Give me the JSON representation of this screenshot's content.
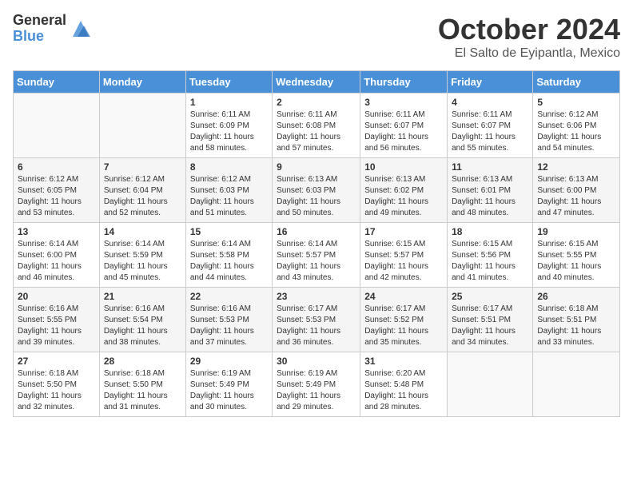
{
  "header": {
    "logo_general": "General",
    "logo_blue": "Blue",
    "month_title": "October 2024",
    "location": "El Salto de Eyipantla, Mexico"
  },
  "days_of_week": [
    "Sunday",
    "Monday",
    "Tuesday",
    "Wednesday",
    "Thursday",
    "Friday",
    "Saturday"
  ],
  "weeks": [
    [
      {
        "day": "",
        "sunrise": "",
        "sunset": "",
        "daylight": ""
      },
      {
        "day": "",
        "sunrise": "",
        "sunset": "",
        "daylight": ""
      },
      {
        "day": "1",
        "sunrise": "Sunrise: 6:11 AM",
        "sunset": "Sunset: 6:09 PM",
        "daylight": "Daylight: 11 hours and 58 minutes."
      },
      {
        "day": "2",
        "sunrise": "Sunrise: 6:11 AM",
        "sunset": "Sunset: 6:08 PM",
        "daylight": "Daylight: 11 hours and 57 minutes."
      },
      {
        "day": "3",
        "sunrise": "Sunrise: 6:11 AM",
        "sunset": "Sunset: 6:07 PM",
        "daylight": "Daylight: 11 hours and 56 minutes."
      },
      {
        "day": "4",
        "sunrise": "Sunrise: 6:11 AM",
        "sunset": "Sunset: 6:07 PM",
        "daylight": "Daylight: 11 hours and 55 minutes."
      },
      {
        "day": "5",
        "sunrise": "Sunrise: 6:12 AM",
        "sunset": "Sunset: 6:06 PM",
        "daylight": "Daylight: 11 hours and 54 minutes."
      }
    ],
    [
      {
        "day": "6",
        "sunrise": "Sunrise: 6:12 AM",
        "sunset": "Sunset: 6:05 PM",
        "daylight": "Daylight: 11 hours and 53 minutes."
      },
      {
        "day": "7",
        "sunrise": "Sunrise: 6:12 AM",
        "sunset": "Sunset: 6:04 PM",
        "daylight": "Daylight: 11 hours and 52 minutes."
      },
      {
        "day": "8",
        "sunrise": "Sunrise: 6:12 AM",
        "sunset": "Sunset: 6:03 PM",
        "daylight": "Daylight: 11 hours and 51 minutes."
      },
      {
        "day": "9",
        "sunrise": "Sunrise: 6:13 AM",
        "sunset": "Sunset: 6:03 PM",
        "daylight": "Daylight: 11 hours and 50 minutes."
      },
      {
        "day": "10",
        "sunrise": "Sunrise: 6:13 AM",
        "sunset": "Sunset: 6:02 PM",
        "daylight": "Daylight: 11 hours and 49 minutes."
      },
      {
        "day": "11",
        "sunrise": "Sunrise: 6:13 AM",
        "sunset": "Sunset: 6:01 PM",
        "daylight": "Daylight: 11 hours and 48 minutes."
      },
      {
        "day": "12",
        "sunrise": "Sunrise: 6:13 AM",
        "sunset": "Sunset: 6:00 PM",
        "daylight": "Daylight: 11 hours and 47 minutes."
      }
    ],
    [
      {
        "day": "13",
        "sunrise": "Sunrise: 6:14 AM",
        "sunset": "Sunset: 6:00 PM",
        "daylight": "Daylight: 11 hours and 46 minutes."
      },
      {
        "day": "14",
        "sunrise": "Sunrise: 6:14 AM",
        "sunset": "Sunset: 5:59 PM",
        "daylight": "Daylight: 11 hours and 45 minutes."
      },
      {
        "day": "15",
        "sunrise": "Sunrise: 6:14 AM",
        "sunset": "Sunset: 5:58 PM",
        "daylight": "Daylight: 11 hours and 44 minutes."
      },
      {
        "day": "16",
        "sunrise": "Sunrise: 6:14 AM",
        "sunset": "Sunset: 5:57 PM",
        "daylight": "Daylight: 11 hours and 43 minutes."
      },
      {
        "day": "17",
        "sunrise": "Sunrise: 6:15 AM",
        "sunset": "Sunset: 5:57 PM",
        "daylight": "Daylight: 11 hours and 42 minutes."
      },
      {
        "day": "18",
        "sunrise": "Sunrise: 6:15 AM",
        "sunset": "Sunset: 5:56 PM",
        "daylight": "Daylight: 11 hours and 41 minutes."
      },
      {
        "day": "19",
        "sunrise": "Sunrise: 6:15 AM",
        "sunset": "Sunset: 5:55 PM",
        "daylight": "Daylight: 11 hours and 40 minutes."
      }
    ],
    [
      {
        "day": "20",
        "sunrise": "Sunrise: 6:16 AM",
        "sunset": "Sunset: 5:55 PM",
        "daylight": "Daylight: 11 hours and 39 minutes."
      },
      {
        "day": "21",
        "sunrise": "Sunrise: 6:16 AM",
        "sunset": "Sunset: 5:54 PM",
        "daylight": "Daylight: 11 hours and 38 minutes."
      },
      {
        "day": "22",
        "sunrise": "Sunrise: 6:16 AM",
        "sunset": "Sunset: 5:53 PM",
        "daylight": "Daylight: 11 hours and 37 minutes."
      },
      {
        "day": "23",
        "sunrise": "Sunrise: 6:17 AM",
        "sunset": "Sunset: 5:53 PM",
        "daylight": "Daylight: 11 hours and 36 minutes."
      },
      {
        "day": "24",
        "sunrise": "Sunrise: 6:17 AM",
        "sunset": "Sunset: 5:52 PM",
        "daylight": "Daylight: 11 hours and 35 minutes."
      },
      {
        "day": "25",
        "sunrise": "Sunrise: 6:17 AM",
        "sunset": "Sunset: 5:51 PM",
        "daylight": "Daylight: 11 hours and 34 minutes."
      },
      {
        "day": "26",
        "sunrise": "Sunrise: 6:18 AM",
        "sunset": "Sunset: 5:51 PM",
        "daylight": "Daylight: 11 hours and 33 minutes."
      }
    ],
    [
      {
        "day": "27",
        "sunrise": "Sunrise: 6:18 AM",
        "sunset": "Sunset: 5:50 PM",
        "daylight": "Daylight: 11 hours and 32 minutes."
      },
      {
        "day": "28",
        "sunrise": "Sunrise: 6:18 AM",
        "sunset": "Sunset: 5:50 PM",
        "daylight": "Daylight: 11 hours and 31 minutes."
      },
      {
        "day": "29",
        "sunrise": "Sunrise: 6:19 AM",
        "sunset": "Sunset: 5:49 PM",
        "daylight": "Daylight: 11 hours and 30 minutes."
      },
      {
        "day": "30",
        "sunrise": "Sunrise: 6:19 AM",
        "sunset": "Sunset: 5:49 PM",
        "daylight": "Daylight: 11 hours and 29 minutes."
      },
      {
        "day": "31",
        "sunrise": "Sunrise: 6:20 AM",
        "sunset": "Sunset: 5:48 PM",
        "daylight": "Daylight: 11 hours and 28 minutes."
      },
      {
        "day": "",
        "sunrise": "",
        "sunset": "",
        "daylight": ""
      },
      {
        "day": "",
        "sunrise": "",
        "sunset": "",
        "daylight": ""
      }
    ]
  ]
}
